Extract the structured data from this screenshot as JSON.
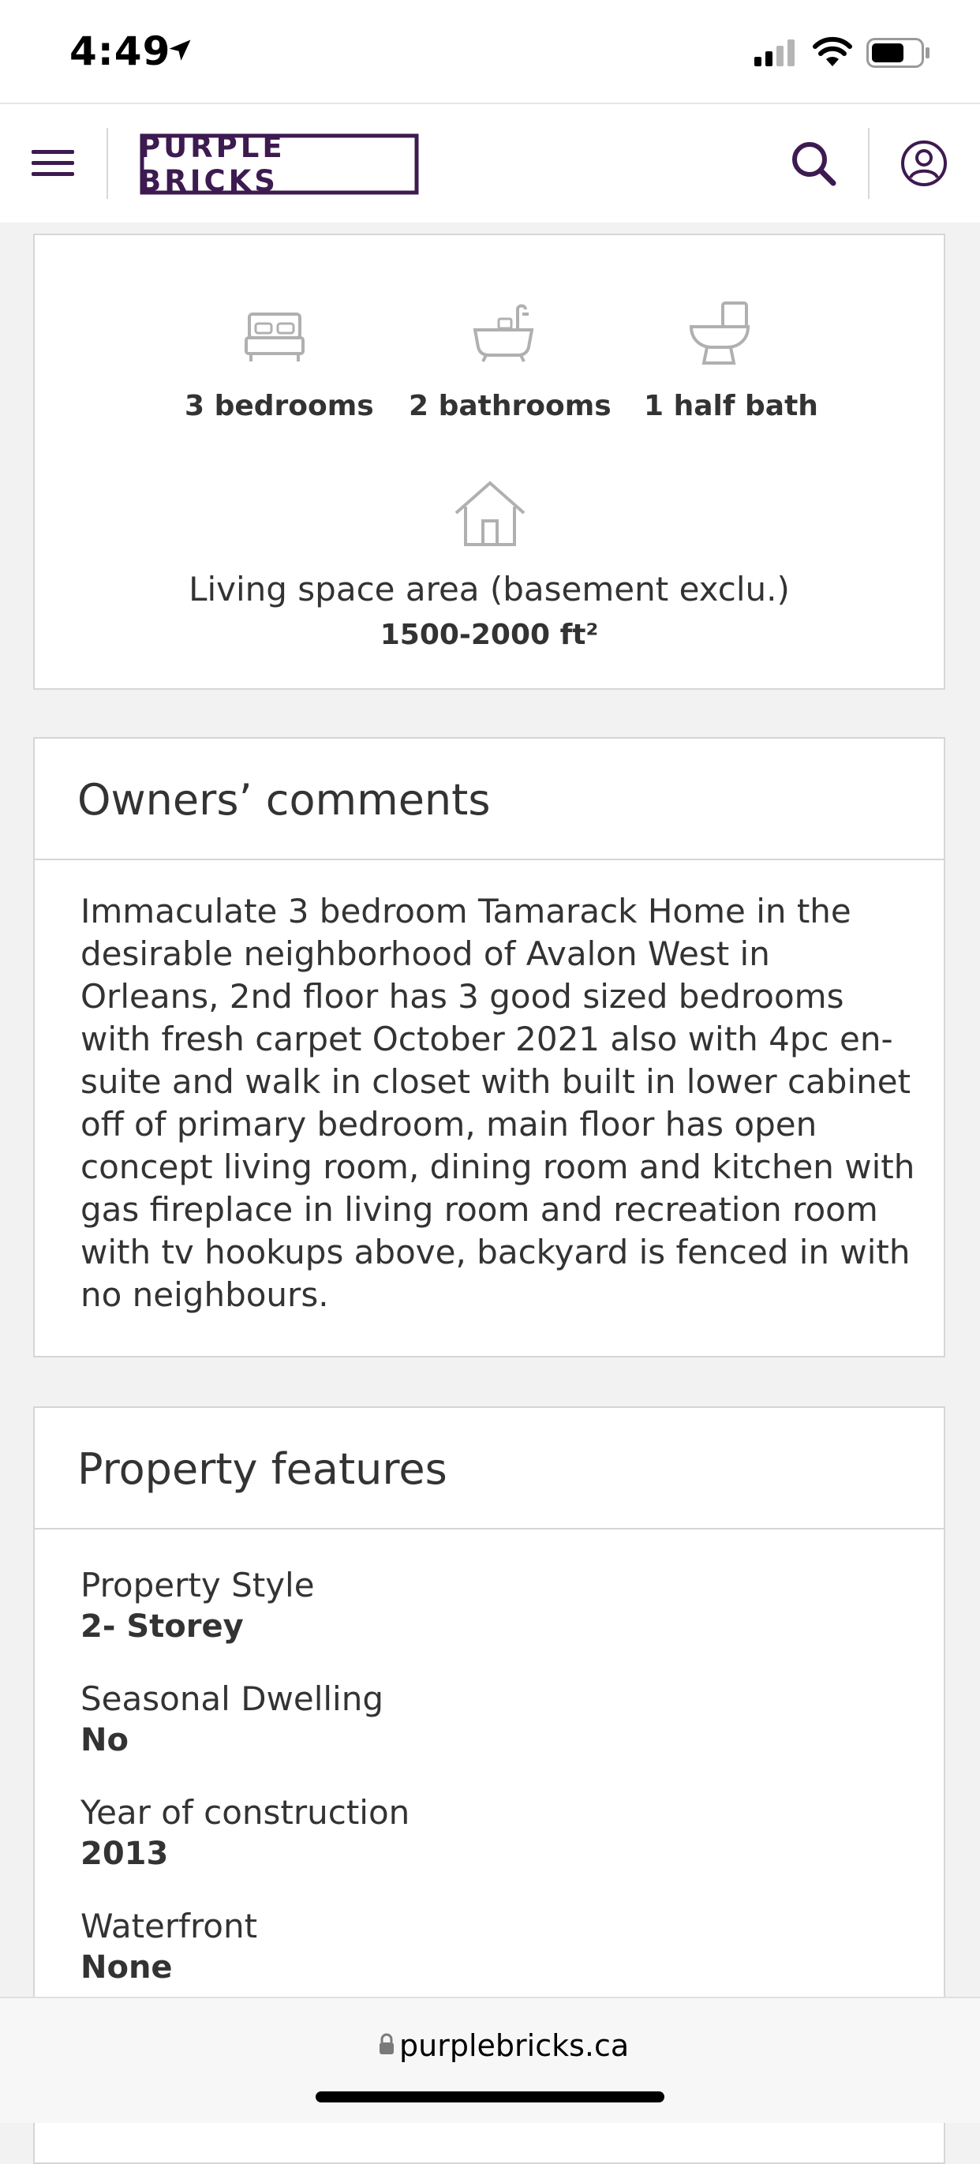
{
  "status_bar": {
    "time": "4:49"
  },
  "header": {
    "logo_text": "PURPLE BRICKS",
    "brand_color": "#3d1a50"
  },
  "stats": {
    "bedrooms": "3 bedrooms",
    "bathrooms": "2 bathrooms",
    "half_bath": "1 half bath",
    "area_label": "Living space area (basement exclu.)",
    "area_value": "1500-2000 ft²"
  },
  "comments": {
    "title": "Owners’ comments",
    "text": "Immaculate 3 bedroom Tamarack Home in the desirable neighborhood of Avalon West in Orleans, 2nd floor has 3 good sized bedrooms with fresh carpet October 2021 also with 4pc en-suite and walk in closet with built in lower cabinet off of primary bedroom, main floor has open concept living room, dining room and kitchen with gas fireplace in living room and recreation room with tv hookups above, backyard is fenced in with no neighbours."
  },
  "features": {
    "title": "Property features",
    "items": [
      {
        "label": "Property Style",
        "value": "2- Storey"
      },
      {
        "label": "Seasonal Dwelling",
        "value": "No"
      },
      {
        "label": "Year of construction",
        "value": "2013"
      },
      {
        "label": "Waterfront",
        "value": "None"
      }
    ]
  },
  "browser": {
    "url": "purplebricks.ca"
  }
}
